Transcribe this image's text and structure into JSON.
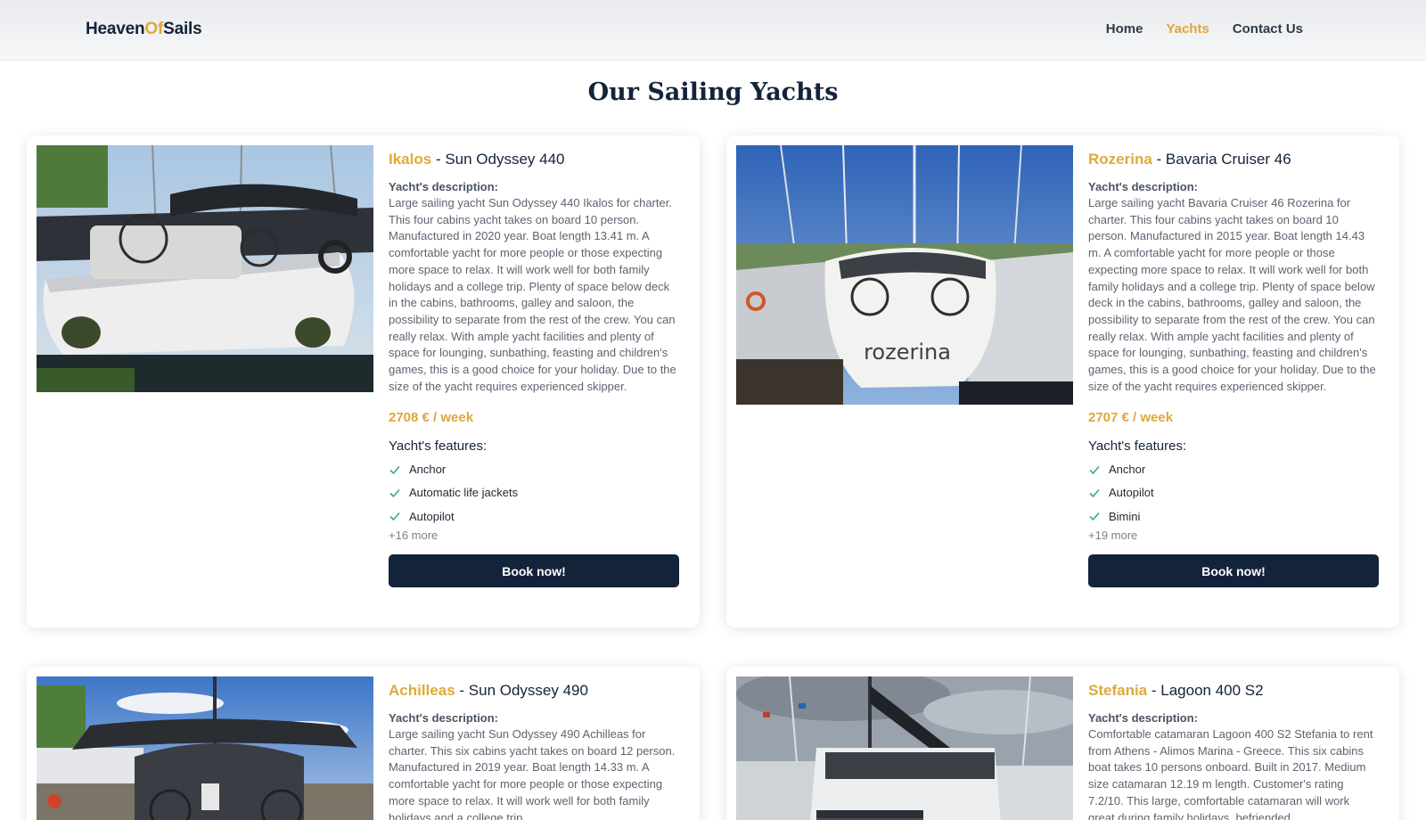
{
  "header": {
    "logo_part1": "Heaven",
    "logo_part2": "Of",
    "logo_part3": "Sails",
    "nav": [
      {
        "label": "Home",
        "active": false
      },
      {
        "label": "Yachts",
        "active": true
      },
      {
        "label": "Contact Us",
        "active": false
      }
    ]
  },
  "page": {
    "title": "Our Sailing Yachts"
  },
  "colors": {
    "accent": "#e0a93a",
    "navy": "#13233a",
    "check": "#3aa88a"
  },
  "yachts": [
    {
      "name": "Ikalos",
      "model": "- Sun Odyssey 440",
      "image_icon": "yacht-photo",
      "desc_label": "Yacht's description:",
      "description": "Large sailing yacht Sun Odyssey 440 Ikalos for charter. This four cabins yacht takes on board 10 person. Manufactured in 2020 year. Boat length 13.41 m. A comfortable yacht for more people or those expecting more space to relax. It will work well for both family holidays and a college trip. Plenty of space below deck in the cabins, bathrooms, galley and saloon, the possibility to separate from the rest of the crew. You can really relax. With ample yacht facilities and plenty of space for lounging, sunbathing, feasting and children's games, this is a good choice for your holiday. Due to the size of the yacht requires experienced skipper.",
      "price": "2708 € / week",
      "features_label": "Yacht's features:",
      "features": [
        "Anchor",
        "Automatic life jackets",
        "Autopilot"
      ],
      "more": "+16 more",
      "button": "Book now!"
    },
    {
      "name": "Rozerina",
      "model": "- Bavaria Cruiser 46",
      "image_icon": "yacht-photo",
      "stern_text": "rozerina",
      "desc_label": "Yacht's description:",
      "description": "Large sailing yacht Bavaria Cruiser 46 Rozerina for charter. This four cabins yacht takes on board 10 person. Manufactured in 2015 year. Boat length 14.43 m. A comfortable yacht for more people or those expecting more space to relax. It will work well for both family holidays and a college trip. Plenty of space below deck in the cabins, bathrooms, galley and saloon, the possibility to separate from the rest of the crew. You can really relax. With ample yacht facilities and plenty of space for lounging, sunbathing, feasting and children's games, this is a good choice for your holiday. Due to the size of the yacht requires experienced skipper.",
      "price": "2707 € / week",
      "features_label": "Yacht's features:",
      "features": [
        "Anchor",
        "Autopilot",
        "Bimini"
      ],
      "more": "+19 more",
      "button": "Book now!"
    },
    {
      "name": "Achilleas",
      "model": "- Sun Odyssey 490",
      "image_icon": "yacht-photo",
      "desc_label": "Yacht's description:",
      "description": "Large sailing yacht Sun Odyssey 490 Achilleas for charter. This six cabins yacht takes on board 12 person. Manufactured in 2019 year. Boat length 14.33 m. A comfortable yacht for more people or those expecting more space to relax. It will work well for both family holidays and a college trip."
    },
    {
      "name": "Stefania",
      "model": "- Lagoon 400 S2",
      "image_icon": "catamaran-photo",
      "desc_label": "Yacht's description:",
      "description": "Comfortable catamaran Lagoon 400 S2 Stefania to rent from Athens - Alimos Marina - Greece. This six cabins boat takes 10 persons onboard. Built in 2017. Medium size catamaran 12.19 m length. Customer's rating 7.2/10. This large, comfortable catamaran will work great during family holidays, befriended"
    }
  ]
}
